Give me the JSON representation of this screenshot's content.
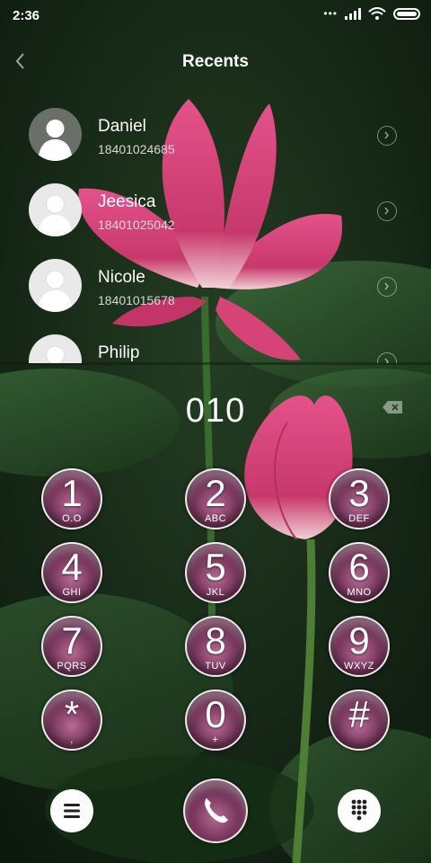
{
  "status": {
    "time": "2:36",
    "dots": "•••"
  },
  "header": {
    "title": "Recents"
  },
  "contacts": [
    {
      "name": "Daniel",
      "number": "18401024685"
    },
    {
      "name": "Jeesica",
      "number": "18401025042"
    },
    {
      "name": "Nicole",
      "number": "18401015678"
    },
    {
      "name": "Philip",
      "number": ""
    }
  ],
  "dialer": {
    "number": "010",
    "keys": [
      {
        "digit": "1",
        "letters": "O.O"
      },
      {
        "digit": "2",
        "letters": "ABC"
      },
      {
        "digit": "3",
        "letters": "DEF"
      },
      {
        "digit": "4",
        "letters": "GHI"
      },
      {
        "digit": "5",
        "letters": "JKL"
      },
      {
        "digit": "6",
        "letters": "MNO"
      },
      {
        "digit": "7",
        "letters": "PQRS"
      },
      {
        "digit": "8",
        "letters": "TUV"
      },
      {
        "digit": "9",
        "letters": "WXYZ"
      },
      {
        "digit": "*",
        "letters": ","
      },
      {
        "digit": "0",
        "letters": "+"
      },
      {
        "digit": "#",
        "letters": ""
      }
    ]
  },
  "icons": {
    "back": "chevron-left-icon",
    "menu": "menu-icon",
    "call": "phone-icon",
    "keypad": "keypad-icon",
    "backspace": "backspace-icon"
  },
  "colors": {
    "key_fill": "#6d2d52",
    "flower": "#d8457a",
    "leaf": "#2f5a31"
  }
}
